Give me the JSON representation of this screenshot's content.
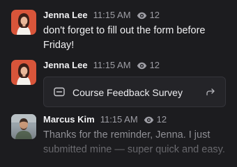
{
  "messages": [
    {
      "author": "Jenna Lee",
      "time": "11:15 AM",
      "views": "12",
      "text": "don't forget to fill out the form before Friday!"
    },
    {
      "author": "Jenna Lee",
      "time": "11:15 AM",
      "views": "12",
      "attachment": {
        "title": "Course Feedback Survey",
        "icon": "form-icon",
        "action_icon": "share-arrow-icon"
      }
    },
    {
      "author": "Marcus Kim",
      "time": "11:15 AM",
      "views": "12",
      "text": "Thanks for the reminder, Jenna. I just submitted mine — super quick and easy."
    }
  ],
  "colors": {
    "background": "#1c1c1f",
    "card_background": "#242428",
    "card_border": "#34343a",
    "muted_text": "#9d9da4"
  }
}
